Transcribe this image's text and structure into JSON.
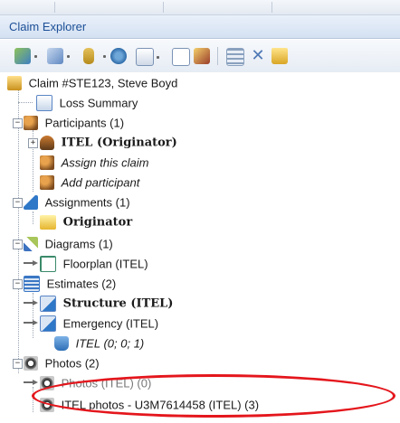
{
  "panel": {
    "title": "Claim Explorer"
  },
  "toolbar": {
    "buttons": [
      "edit-icon",
      "document-icon",
      "money-icon",
      "refresh-icon",
      "page-icon",
      "new-page-icon",
      "pen-icon",
      "list-icon",
      "delete-icon",
      "folder-icon"
    ]
  },
  "tree": {
    "root": "Claim #STE123, Steve Boyd",
    "loss_summary": "Loss Summary",
    "participants": "Participants (1)",
    "itel_originator": "ITEL (Originator)",
    "assign_claim": "Assign this claim",
    "add_participant": "Add participant",
    "assignments": "Assignments (1)",
    "originator": "Originator",
    "diagrams": "Diagrams (1)",
    "floorplan": "Floorplan (ITEL)",
    "estimates": "Estimates (2)",
    "structure": "Structure (ITEL)",
    "emergency": "Emergency (ITEL)",
    "itel_counts": "ITEL (0; 0; 1)",
    "photos": "Photos (2)",
    "photos_itel": "Photos (ITEL) (0)",
    "itel_photos": "ITEL photos - U3M7614458 (ITEL) (3)"
  },
  "colors": {
    "title_text": "#1c4f97",
    "highlight_ring": "#e4161c"
  }
}
